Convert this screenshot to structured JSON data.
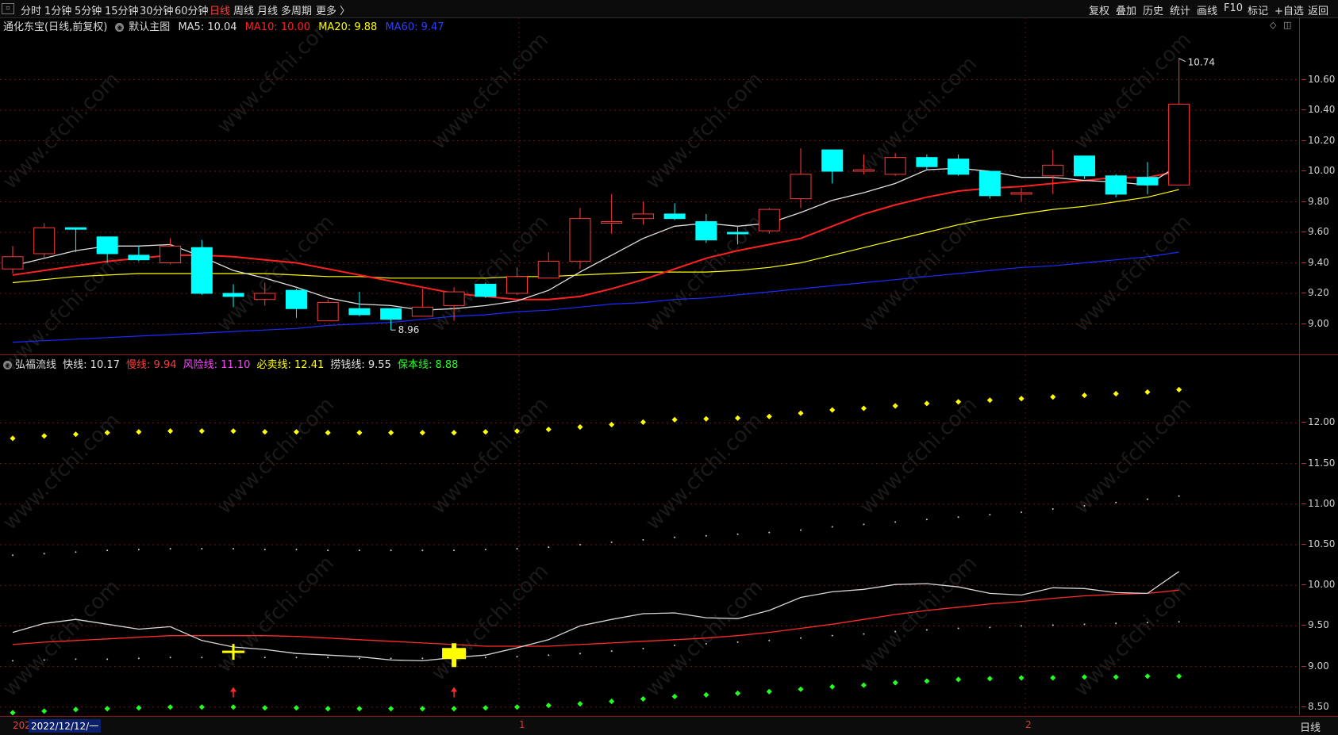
{
  "toolbar": {
    "periods": [
      "分时",
      "1分钟",
      "5分钟",
      "15分钟",
      "30分钟",
      "60分钟",
      "日线",
      "周线",
      "月线",
      "多周期",
      "更多 〉"
    ],
    "active_period": "日线",
    "tools": [
      "复权",
      "叠加",
      "历史",
      "统计",
      "画线",
      "F10",
      "标记",
      "+自选",
      "返回"
    ]
  },
  "main_info": {
    "stock": "通化东宝(日线,前复权)",
    "indicator": "默认主图",
    "ma5": "MA5: 10.04",
    "ma10": "MA10: 10.00",
    "ma20": "MA20: 9.88",
    "ma60": "MA60: 9.47"
  },
  "sub_info": {
    "name": "弘福流线",
    "fast": "快线: 10.17",
    "slow": "慢线: 9.94",
    "risk": "风险线: 11.10",
    "sell": "必卖线: 12.41",
    "fish": "捞钱线: 9.55",
    "safe": "保本线: 8.88"
  },
  "colors": {
    "up": "#ff3b3b",
    "down": "#00ffff",
    "ma5": "#e0e0e0",
    "ma10": "#ff2020",
    "ma20": "#ffff00",
    "ma60": "#1a2cff",
    "axis": "#8b1a1a"
  },
  "main_axis": {
    "ticks": [
      "10.60",
      "10.40",
      "10.20",
      "10.00",
      "9.80",
      "9.60",
      "9.40",
      "9.20",
      "9.00"
    ],
    "min": 8.8,
    "max": 10.8
  },
  "sub_axis": {
    "ticks": [
      "12.00",
      "11.50",
      "11.00",
      "10.50",
      "10.00",
      "9.50",
      "9.00",
      "8.50"
    ],
    "min": 8.4,
    "max": 12.6
  },
  "annotations": {
    "high_label": "10.74",
    "low_label": "8.96"
  },
  "watermark": "www.cfchi.com",
  "bottom": {
    "date_prefix": "202",
    "date": "2022/12/12/一",
    "day_button": "日线",
    "marker1": "1",
    "marker2": "2"
  },
  "candles": [
    {
      "o": 9.36,
      "c": 9.44,
      "h": 9.51,
      "l": 9.33
    },
    {
      "o": 9.46,
      "c": 9.63,
      "h": 9.66,
      "l": 9.43
    },
    {
      "o": 9.63,
      "c": 9.62,
      "h": 9.63,
      "l": 9.47
    },
    {
      "o": 9.57,
      "c": 9.46,
      "h": 9.57,
      "l": 9.4
    },
    {
      "o": 9.45,
      "c": 9.42,
      "h": 9.51,
      "l": 9.41
    },
    {
      "o": 9.4,
      "c": 9.51,
      "h": 9.56,
      "l": 9.39
    },
    {
      "o": 9.5,
      "c": 9.2,
      "h": 9.55,
      "l": 9.19
    },
    {
      "o": 9.2,
      "c": 9.18,
      "h": 9.26,
      "l": 9.11
    },
    {
      "o": 9.16,
      "c": 9.2,
      "h": 9.27,
      "l": 9.12
    },
    {
      "o": 9.22,
      "c": 9.1,
      "h": 9.23,
      "l": 9.04
    },
    {
      "o": 9.02,
      "c": 9.14,
      "h": 9.16,
      "l": 9.02
    },
    {
      "o": 9.1,
      "c": 9.06,
      "h": 9.21,
      "l": 9.05
    },
    {
      "o": 9.1,
      "c": 9.03,
      "h": 9.1,
      "l": 8.96
    },
    {
      "o": 9.05,
      "c": 9.11,
      "h": 9.23,
      "l": 9.05
    },
    {
      "o": 9.12,
      "c": 9.21,
      "h": 9.24,
      "l": 9.02
    },
    {
      "o": 9.26,
      "c": 9.18,
      "h": 9.27,
      "l": 9.17
    },
    {
      "o": 9.2,
      "c": 9.31,
      "h": 9.37,
      "l": 9.19
    },
    {
      "o": 9.3,
      "c": 9.41,
      "h": 9.47,
      "l": 9.3
    },
    {
      "o": 9.41,
      "c": 9.69,
      "h": 9.76,
      "l": 9.36
    },
    {
      "o": 9.66,
      "c": 9.67,
      "h": 9.85,
      "l": 9.59
    },
    {
      "o": 9.69,
      "c": 9.72,
      "h": 9.8,
      "l": 9.65
    },
    {
      "o": 9.72,
      "c": 9.69,
      "h": 9.79,
      "l": 9.68
    },
    {
      "o": 9.67,
      "c": 9.55,
      "h": 9.72,
      "l": 9.53
    },
    {
      "o": 9.6,
      "c": 9.59,
      "h": 9.64,
      "l": 9.52
    },
    {
      "o": 9.61,
      "c": 9.75,
      "h": 9.76,
      "l": 9.59
    },
    {
      "o": 9.82,
      "c": 9.98,
      "h": 10.15,
      "l": 9.76
    },
    {
      "o": 10.14,
      "c": 10.0,
      "h": 10.14,
      "l": 9.92
    },
    {
      "o": 10.0,
      "c": 10.01,
      "h": 10.11,
      "l": 9.98
    },
    {
      "o": 9.98,
      "c": 10.09,
      "h": 10.12,
      "l": 9.97
    },
    {
      "o": 10.09,
      "c": 10.03,
      "h": 10.11,
      "l": 10.01
    },
    {
      "o": 10.08,
      "c": 9.98,
      "h": 10.11,
      "l": 9.97
    },
    {
      "o": 10.0,
      "c": 9.84,
      "h": 10.0,
      "l": 9.82
    },
    {
      "o": 9.85,
      "c": 9.86,
      "h": 9.89,
      "l": 9.8
    },
    {
      "o": 9.97,
      "c": 10.04,
      "h": 10.14,
      "l": 9.85
    },
    {
      "o": 10.1,
      "c": 9.97,
      "h": 10.1,
      "l": 9.95
    },
    {
      "o": 9.97,
      "c": 9.85,
      "h": 9.98,
      "l": 9.83
    },
    {
      "o": 9.96,
      "c": 9.91,
      "h": 10.06,
      "l": 9.85
    },
    {
      "o": 9.91,
      "c": 10.44,
      "h": 10.74,
      "l": 9.91
    }
  ],
  "ma5": [
    9.38,
    9.43,
    9.48,
    9.51,
    9.51,
    9.52,
    9.44,
    9.35,
    9.3,
    9.24,
    9.17,
    9.13,
    9.12,
    9.09,
    9.1,
    9.12,
    9.15,
    9.22,
    9.34,
    9.45,
    9.56,
    9.64,
    9.66,
    9.64,
    9.66,
    9.73,
    9.81,
    9.86,
    9.92,
    10.01,
    10.02,
    10.0,
    9.96,
    9.96,
    9.94,
    9.93,
    9.91,
    10.04
  ],
  "ma10": [
    9.32,
    9.35,
    9.38,
    9.41,
    9.43,
    9.45,
    9.45,
    9.44,
    9.42,
    9.4,
    9.36,
    9.32,
    9.28,
    9.24,
    9.2,
    9.18,
    9.16,
    9.16,
    9.18,
    9.23,
    9.29,
    9.36,
    9.43,
    9.48,
    9.52,
    9.56,
    9.64,
    9.72,
    9.78,
    9.83,
    9.87,
    9.89,
    9.9,
    9.92,
    9.94,
    9.96,
    9.96,
    10.0
  ],
  "ma20": [
    9.27,
    9.29,
    9.31,
    9.32,
    9.33,
    9.33,
    9.33,
    9.33,
    9.33,
    9.32,
    9.31,
    9.31,
    9.3,
    9.3,
    9.3,
    9.3,
    9.31,
    9.31,
    9.32,
    9.33,
    9.34,
    9.34,
    9.34,
    9.35,
    9.37,
    9.4,
    9.45,
    9.5,
    9.55,
    9.6,
    9.65,
    9.69,
    9.72,
    9.75,
    9.77,
    9.8,
    9.83,
    9.88
  ],
  "ma60": [
    8.88,
    8.89,
    8.9,
    8.91,
    8.92,
    8.93,
    8.94,
    8.95,
    8.96,
    8.97,
    8.99,
    9.0,
    9.01,
    9.03,
    9.05,
    9.06,
    9.08,
    9.09,
    9.11,
    9.13,
    9.14,
    9.16,
    9.17,
    9.19,
    9.21,
    9.23,
    9.25,
    9.27,
    9.29,
    9.31,
    9.33,
    9.35,
    9.37,
    9.38,
    9.4,
    9.42,
    9.44,
    9.47
  ],
  "fast": [
    9.42,
    9.53,
    9.58,
    9.52,
    9.46,
    9.49,
    9.32,
    9.24,
    9.21,
    9.16,
    9.14,
    9.12,
    9.08,
    9.07,
    9.11,
    9.14,
    9.23,
    9.33,
    9.5,
    9.58,
    9.65,
    9.66,
    9.6,
    9.59,
    9.69,
    9.85,
    9.92,
    9.95,
    10.01,
    10.02,
    9.98,
    9.9,
    9.88,
    9.97,
    9.96,
    9.91,
    9.9,
    10.17
  ],
  "slow": [
    9.27,
    9.3,
    9.32,
    9.34,
    9.36,
    9.38,
    9.38,
    9.38,
    9.38,
    9.37,
    9.35,
    9.33,
    9.31,
    9.29,
    9.27,
    9.25,
    9.25,
    9.25,
    9.27,
    9.29,
    9.31,
    9.33,
    9.35,
    9.38,
    9.42,
    9.47,
    9.52,
    9.58,
    9.64,
    9.69,
    9.73,
    9.77,
    9.8,
    9.84,
    9.87,
    9.89,
    9.9,
    9.94
  ],
  "sell": [
    11.81,
    11.84,
    11.86,
    11.88,
    11.89,
    11.9,
    11.9,
    11.9,
    11.89,
    11.89,
    11.88,
    11.88,
    11.88,
    11.88,
    11.88,
    11.89,
    11.9,
    11.92,
    11.95,
    11.98,
    12.01,
    12.04,
    12.05,
    12.06,
    12.08,
    12.12,
    12.16,
    12.18,
    12.21,
    12.24,
    12.26,
    12.28,
    12.3,
    12.32,
    12.34,
    12.36,
    12.38,
    12.41
  ],
  "fish": [
    9.07,
    9.08,
    9.09,
    9.09,
    9.1,
    9.11,
    9.11,
    9.11,
    9.11,
    9.11,
    9.11,
    9.1,
    9.1,
    9.1,
    9.1,
    9.11,
    9.12,
    9.14,
    9.16,
    9.19,
    9.22,
    9.26,
    9.28,
    9.3,
    9.32,
    9.35,
    9.38,
    9.4,
    9.43,
    9.45,
    9.47,
    9.48,
    9.5,
    9.51,
    9.52,
    9.53,
    9.54,
    9.55
  ],
  "safe": [
    8.43,
    8.45,
    8.47,
    8.48,
    8.49,
    8.5,
    8.5,
    8.5,
    8.49,
    8.49,
    8.48,
    8.48,
    8.48,
    8.48,
    8.48,
    8.49,
    8.5,
    8.52,
    8.54,
    8.57,
    8.6,
    8.63,
    8.65,
    8.67,
    8.69,
    8.72,
    8.75,
    8.77,
    8.8,
    8.82,
    8.84,
    8.85,
    8.86,
    8.86,
    8.87,
    8.87,
    8.88,
    8.88
  ],
  "risk": [
    10.37,
    10.39,
    10.41,
    10.43,
    10.44,
    10.45,
    10.45,
    10.45,
    10.44,
    10.44,
    10.43,
    10.43,
    10.43,
    10.43,
    10.43,
    10.44,
    10.45,
    10.47,
    10.5,
    10.53,
    10.56,
    10.59,
    10.61,
    10.63,
    10.65,
    10.68,
    10.72,
    10.75,
    10.78,
    10.81,
    10.84,
    10.87,
    10.9,
    10.94,
    10.98,
    11.02,
    11.06,
    11.1
  ],
  "buy_signals": [
    7,
    14
  ]
}
